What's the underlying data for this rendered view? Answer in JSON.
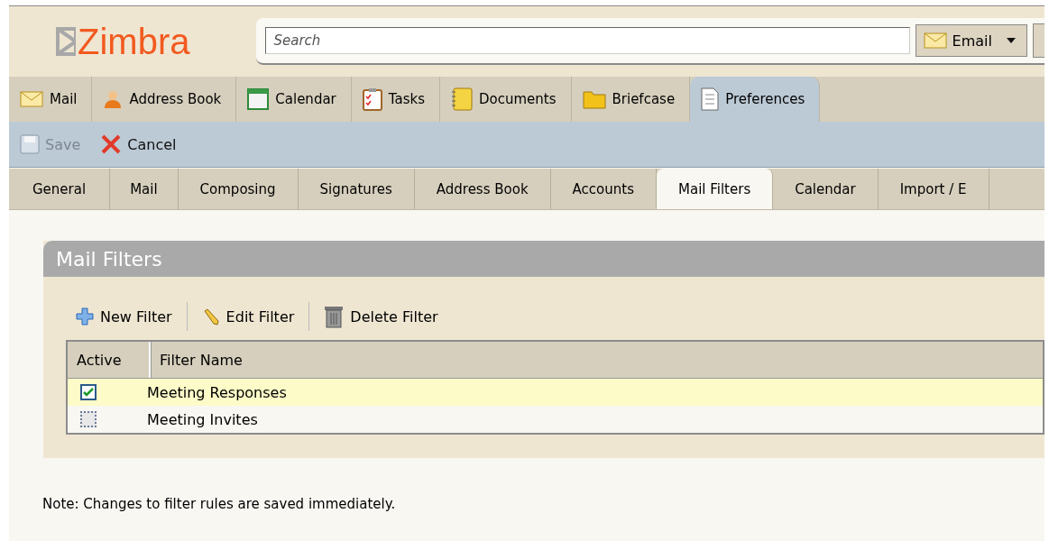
{
  "logo": {
    "text": "Zimbra"
  },
  "search": {
    "placeholder": "Search",
    "scope": "Email"
  },
  "app_tabs": [
    {
      "label": "Mail",
      "selected": false
    },
    {
      "label": "Address Book",
      "selected": false
    },
    {
      "label": "Calendar",
      "selected": false
    },
    {
      "label": "Tasks",
      "selected": false
    },
    {
      "label": "Documents",
      "selected": false
    },
    {
      "label": "Briefcase",
      "selected": false
    },
    {
      "label": "Preferences",
      "selected": true
    }
  ],
  "toolbar": [
    {
      "label": "Save",
      "disabled": true
    },
    {
      "label": "Cancel",
      "disabled": false
    }
  ],
  "pref_tabs": [
    {
      "label": "General",
      "selected": false
    },
    {
      "label": "Mail",
      "selected": false
    },
    {
      "label": "Composing",
      "selected": false
    },
    {
      "label": "Signatures",
      "selected": false
    },
    {
      "label": "Address Book",
      "selected": false
    },
    {
      "label": "Accounts",
      "selected": false
    },
    {
      "label": "Mail Filters",
      "selected": true
    },
    {
      "label": "Calendar",
      "selected": false
    },
    {
      "label": "Import / E",
      "selected": false
    }
  ],
  "panel": {
    "title": "Mail Filters",
    "actions": [
      {
        "label": "New Filter"
      },
      {
        "label": "Edit Filter"
      },
      {
        "label": "Delete Filter"
      }
    ],
    "table": {
      "columns": [
        "Active",
        "Filter Name"
      ],
      "rows": [
        {
          "active": true,
          "name": "Meeting Responses",
          "selected": true
        },
        {
          "active": false,
          "name": "Meeting Invites",
          "selected": false
        }
      ]
    }
  },
  "note": "Note: Changes to filter rules are saved immediately."
}
